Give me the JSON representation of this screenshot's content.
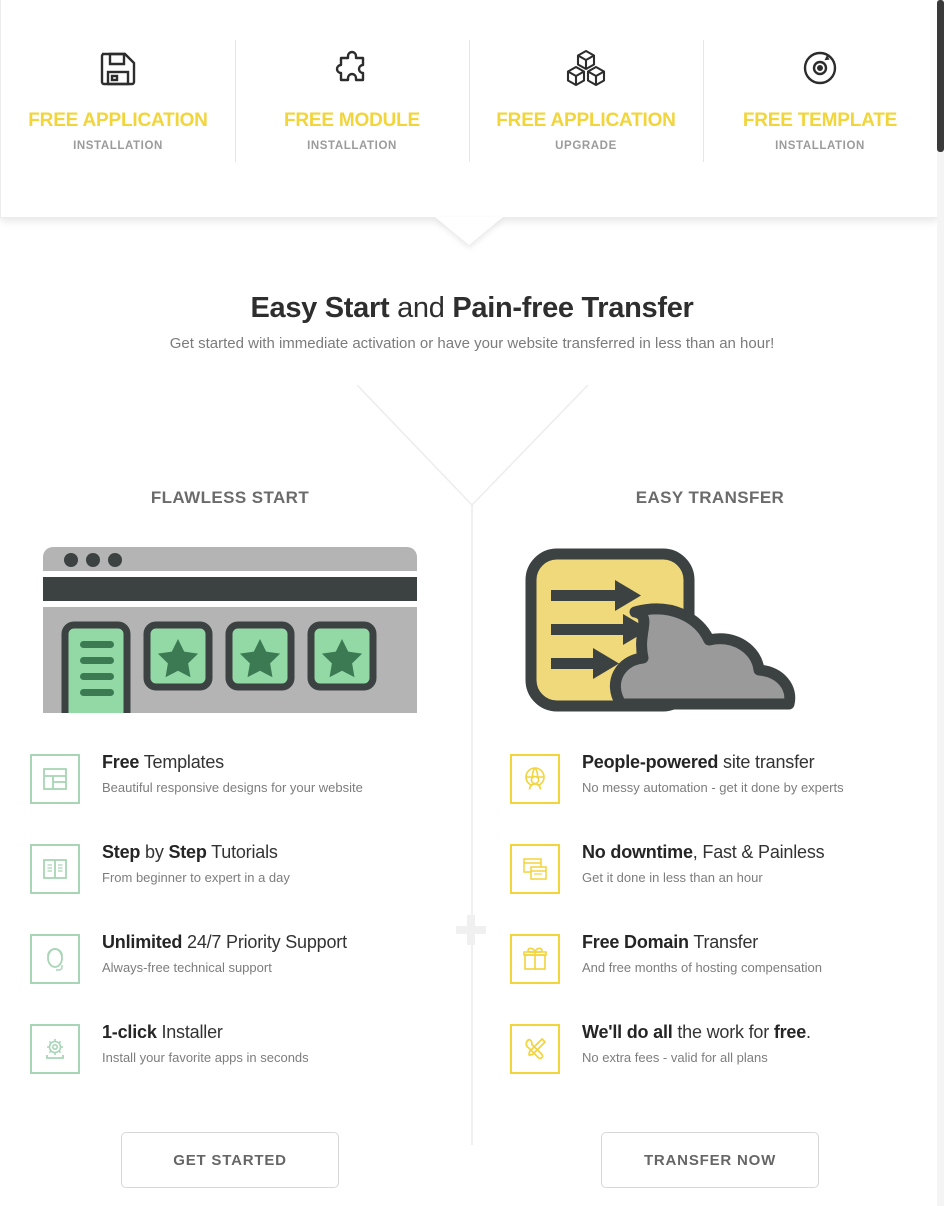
{
  "banner": {
    "items": [
      {
        "icon": "floppy-disk-icon",
        "title": "FREE APPLICATION",
        "subtitle": "INSTALLATION"
      },
      {
        "icon": "puzzle-piece-icon",
        "title": "FREE MODULE",
        "subtitle": "INSTALLATION"
      },
      {
        "icon": "cubes-icon",
        "title": "FREE APPLICATION",
        "subtitle": "UPGRADE"
      },
      {
        "icon": "disc-refresh-icon",
        "title": "FREE TEMPLATE",
        "subtitle": "INSTALLATION"
      }
    ]
  },
  "hero": {
    "title_part1": "Easy Start",
    "title_mid": " and ",
    "title_part2": "Pain-free Transfer",
    "subtitle": "Get started with immediate activation or have your website transferred in less than an hour!"
  },
  "columns": {
    "left": {
      "heading": "FLAWLESS START",
      "illustration": "browser-window-templates-illustration",
      "accent_color": "#a8d5b5",
      "features": [
        {
          "icon": "layout-template-icon",
          "title_bold": "Free",
          "title_rest": " Templates",
          "desc": "Beautiful responsive designs for your website"
        },
        {
          "icon": "open-book-icon",
          "title_bold": "Step",
          "title_mid": " by ",
          "title_bold2": "Step",
          "title_rest": " Tutorials",
          "desc": "From beginner to expert in a day"
        },
        {
          "icon": "headset-icon",
          "title_bold": "Unlimited",
          "title_rest": " 24/7 Priority Support",
          "desc": "Always-free technical support"
        },
        {
          "icon": "gear-install-icon",
          "title_bold": "1-click",
          "title_rest": " Installer",
          "desc": "Install your favorite apps in seconds"
        }
      ],
      "cta_label": "GET STARTED"
    },
    "right": {
      "heading": "EASY TRANSFER",
      "illustration": "transfer-to-cloud-illustration",
      "accent_color": "#f2d43b",
      "features": [
        {
          "icon": "globe-person-icon",
          "title_bold": "People-powered",
          "title_rest": " site transfer",
          "desc": "No messy automation - get it done by experts"
        },
        {
          "icon": "browser-windows-icon",
          "title_bold": "No downtime",
          "title_rest": ", Fast & Painless",
          "desc": "Get it done in less than an hour"
        },
        {
          "icon": "gift-icon",
          "title_bold": "Free Domain",
          "title_rest": " Transfer",
          "desc": "And free months of hosting compensation"
        },
        {
          "icon": "tools-icon",
          "title_bold": "We'll do all",
          "title_mid": " the work for ",
          "title_bold2": "free",
          "title_rest": ".",
          "desc": "No extra fees - valid for all plans"
        }
      ],
      "cta_label": "TRANSFER NOW"
    }
  },
  "decorations": {
    "plus_separator": "+",
    "colors": {
      "yellow": "#f2d43b",
      "green": "#a8d5b5",
      "dark": "#3c3c3c",
      "gray": "#9b9b9b"
    }
  }
}
